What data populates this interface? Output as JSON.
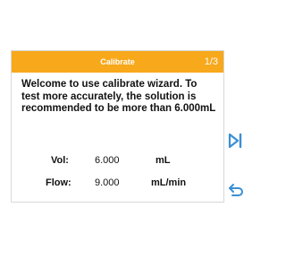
{
  "dialog": {
    "title": "Calibrate",
    "page_indicator": "1/3",
    "message": "Welcome to use calibrate wizard. To test more accurately, the solution is recommended to be more than 6.000mL",
    "fields": {
      "vol": {
        "label": "Vol:",
        "value": "6.000",
        "unit": "mL"
      },
      "flow": {
        "label": "Flow:",
        "value": "9.000",
        "unit": "mL/min"
      }
    }
  },
  "controls": {
    "next_icon": "skip-next-icon",
    "back_icon": "return-icon"
  },
  "colors": {
    "header": "#f7a81b",
    "icon_blue": "#3a8fd6"
  }
}
